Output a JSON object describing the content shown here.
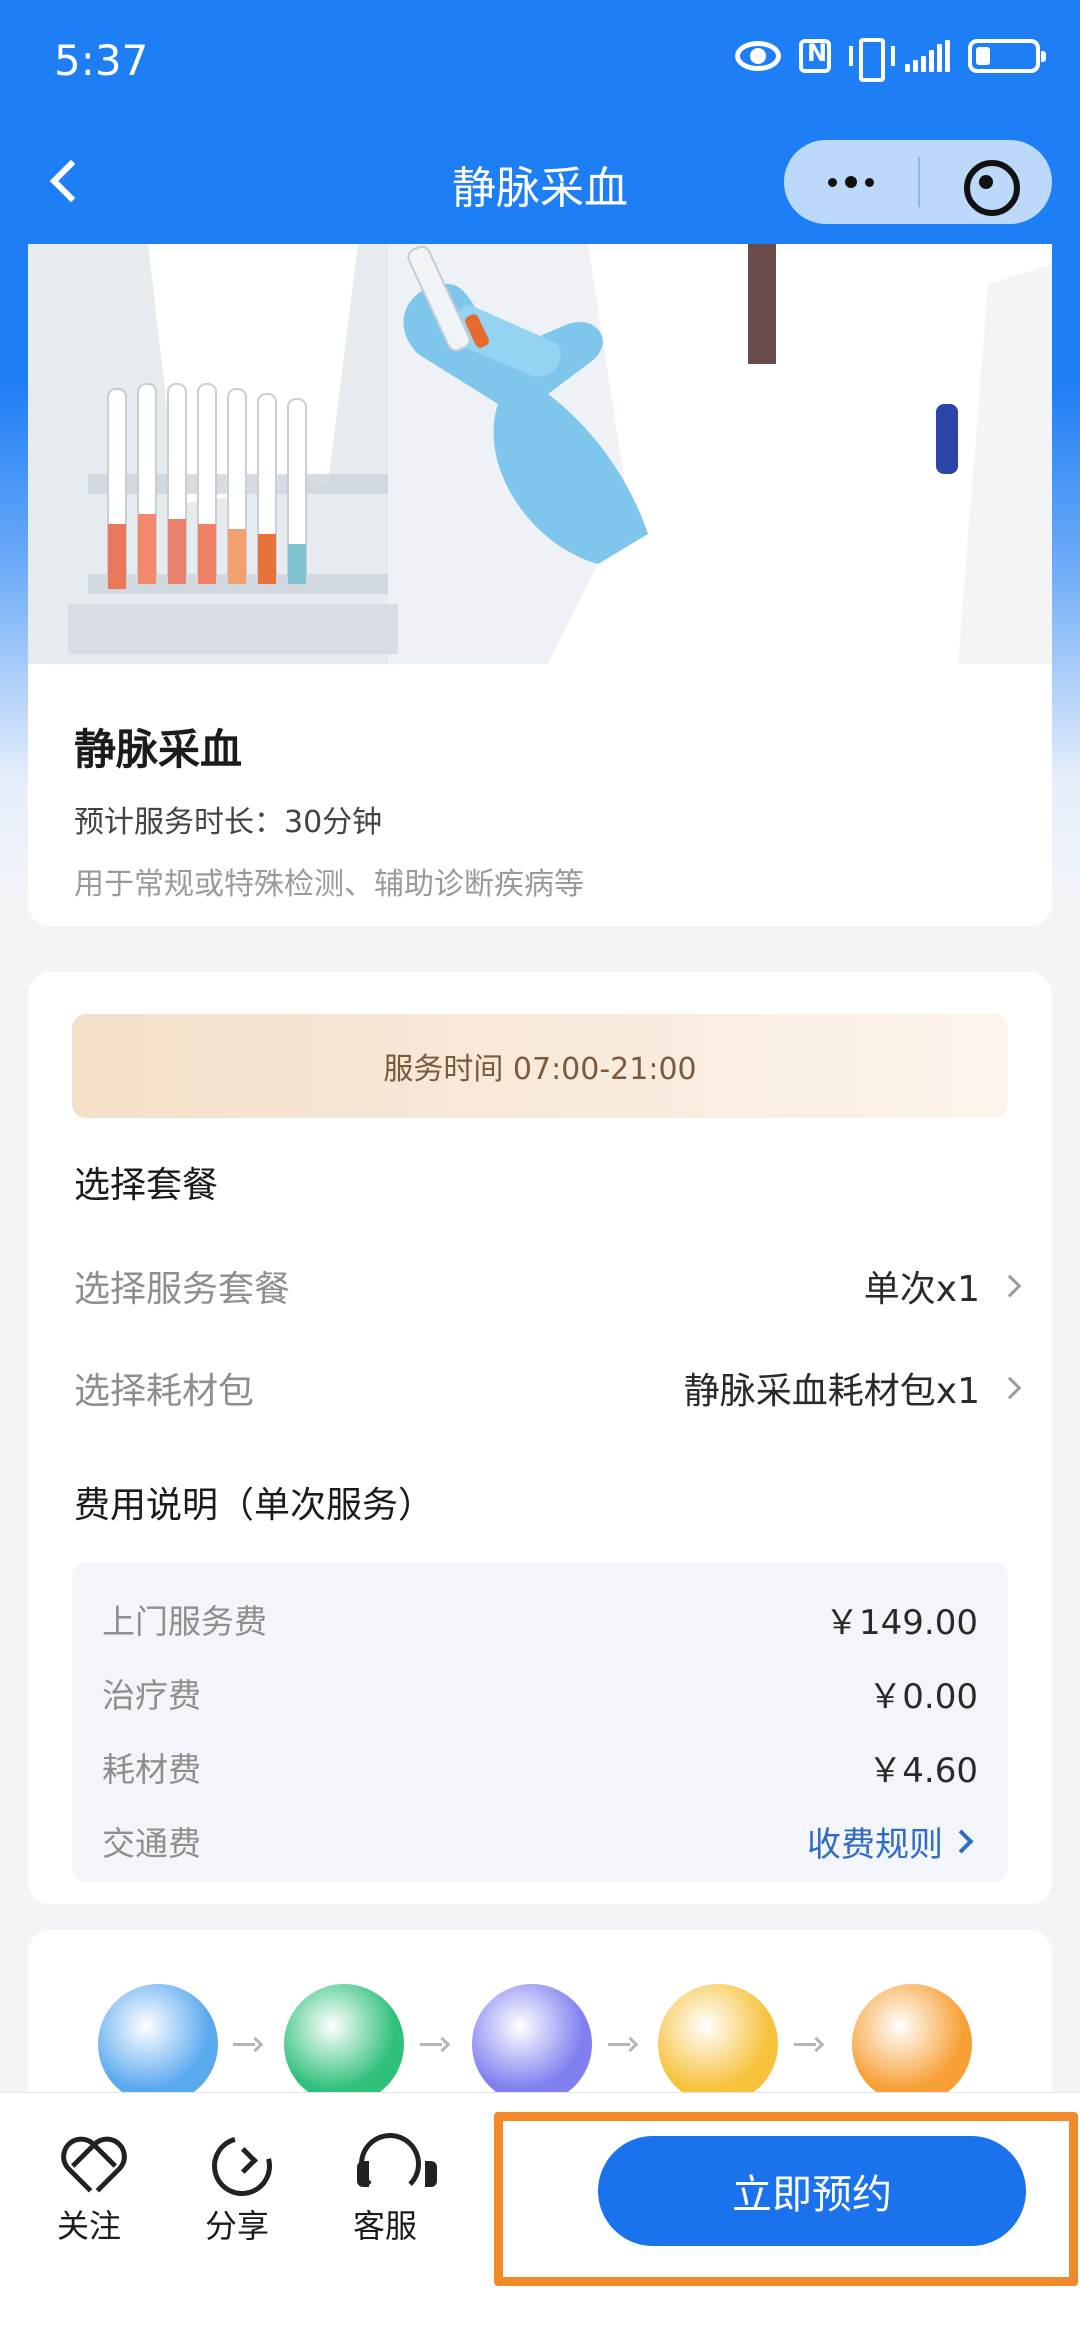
{
  "status_bar": {
    "time": "5:37"
  },
  "nav": {
    "title": "静脉采血"
  },
  "hero": {
    "name": "静脉采血",
    "duration": "预计服务时长：30分钟",
    "description": "用于常规或特殊检测、辅助诊断疾病等"
  },
  "package": {
    "service_hours": "服务时间 07:00-21:00",
    "section_title": "选择套餐",
    "service_option": {
      "label": "选择服务套餐",
      "value": "单次x1"
    },
    "material_option": {
      "label": "选择耗材包",
      "value": "静脉采血耗材包x1"
    },
    "fee_title": "费用说明（单次服务）",
    "fees": [
      {
        "label": "上门服务费",
        "value": "￥149.00"
      },
      {
        "label": "治疗费",
        "value": "￥0.00"
      },
      {
        "label": "耗材费",
        "value": "￥4.60"
      },
      {
        "label": "交通费",
        "value": "收费规则"
      }
    ]
  },
  "process_steps": [
    {
      "icon": "customer-service-icon",
      "color": "#5aa9ef"
    },
    {
      "icon": "payment-receipt-icon",
      "color": "#2fc07a"
    },
    {
      "icon": "checklist-icon",
      "color": "#7f7ff0"
    },
    {
      "icon": "nurse-icon",
      "color": "#f6c23a"
    },
    {
      "icon": "flower-icon",
      "color": "#f7a035"
    }
  ],
  "bottom_bar": {
    "follow": "关注",
    "share": "分享",
    "service": "客服",
    "book": "立即预约"
  },
  "colors": {
    "primary": "#1e7ef5",
    "book_button": "#1a73ec",
    "highlight": "#f08a2a",
    "link": "#2f6cc4"
  }
}
